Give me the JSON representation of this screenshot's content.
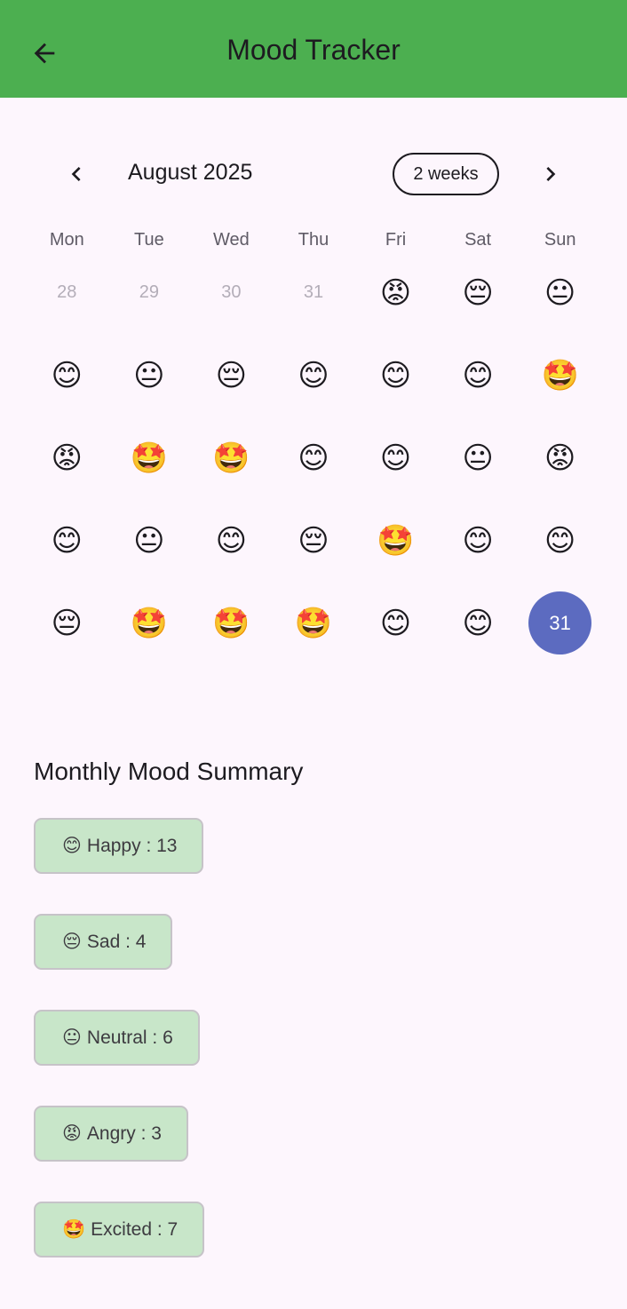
{
  "appbar": {
    "title": "Mood Tracker",
    "back_icon": "arrow-left-icon"
  },
  "calendar": {
    "month_title": "August 2025",
    "format_button": "2 weeks",
    "prev_icon": "chevron-left-icon",
    "next_icon": "chevron-right-icon",
    "weekdays": [
      "Mon",
      "Tue",
      "Wed",
      "Thu",
      "Fri",
      "Sat",
      "Sun"
    ],
    "weeks": [
      [
        {
          "type": "outside",
          "text": "28"
        },
        {
          "type": "outside",
          "text": "29"
        },
        {
          "type": "outside",
          "text": "30"
        },
        {
          "type": "outside",
          "text": "31"
        },
        {
          "type": "mood",
          "text": "😡",
          "mood": "angry"
        },
        {
          "type": "mood",
          "text": "😔",
          "mood": "sad"
        },
        {
          "type": "mood",
          "text": "😐",
          "mood": "neutral"
        }
      ],
      [
        {
          "type": "mood",
          "text": "😊",
          "mood": "happy"
        },
        {
          "type": "mood",
          "text": "😐",
          "mood": "neutral"
        },
        {
          "type": "mood",
          "text": "😔",
          "mood": "sad"
        },
        {
          "type": "mood",
          "text": "😊",
          "mood": "happy"
        },
        {
          "type": "mood",
          "text": "😊",
          "mood": "happy"
        },
        {
          "type": "mood",
          "text": "😊",
          "mood": "happy"
        },
        {
          "type": "mood",
          "text": "🤩",
          "mood": "excited"
        }
      ],
      [
        {
          "type": "mood",
          "text": "😡",
          "mood": "angry"
        },
        {
          "type": "mood",
          "text": "🤩",
          "mood": "excited"
        },
        {
          "type": "mood",
          "text": "🤩",
          "mood": "excited"
        },
        {
          "type": "mood",
          "text": "😊",
          "mood": "happy"
        },
        {
          "type": "mood",
          "text": "😊",
          "mood": "happy"
        },
        {
          "type": "mood",
          "text": "😐",
          "mood": "neutral"
        },
        {
          "type": "mood",
          "text": "😡",
          "mood": "angry"
        }
      ],
      [
        {
          "type": "mood",
          "text": "😊",
          "mood": "happy"
        },
        {
          "type": "mood",
          "text": "😐",
          "mood": "neutral"
        },
        {
          "type": "mood",
          "text": "😊",
          "mood": "happy"
        },
        {
          "type": "mood",
          "text": "😔",
          "mood": "sad"
        },
        {
          "type": "mood",
          "text": "🤩",
          "mood": "excited"
        },
        {
          "type": "mood",
          "text": "😊",
          "mood": "happy"
        },
        {
          "type": "mood",
          "text": "😊",
          "mood": "happy"
        }
      ],
      [
        {
          "type": "mood",
          "text": "😔",
          "mood": "sad"
        },
        {
          "type": "mood",
          "text": "🤩",
          "mood": "excited"
        },
        {
          "type": "mood",
          "text": "🤩",
          "mood": "excited"
        },
        {
          "type": "mood",
          "text": "🤩",
          "mood": "excited"
        },
        {
          "type": "mood",
          "text": "😊",
          "mood": "happy"
        },
        {
          "type": "mood",
          "text": "😊",
          "mood": "happy"
        },
        {
          "type": "today",
          "text": "31"
        }
      ]
    ],
    "today_color": "#5c6bc0"
  },
  "summary": {
    "title": "Monthly Mood Summary",
    "chips": [
      {
        "emoji": "😊",
        "label": "Happy : 13"
      },
      {
        "emoji": "😔",
        "label": "Sad : 4"
      },
      {
        "emoji": "😐",
        "label": "Neutral : 6"
      },
      {
        "emoji": "😡",
        "label": "Angry : 3"
      },
      {
        "emoji": "🤩",
        "label": "Excited : 7"
      }
    ]
  },
  "colors": {
    "appbar": "#4caf50",
    "chip_bg": "#c8e6c9",
    "background": "#fdf6fd"
  }
}
